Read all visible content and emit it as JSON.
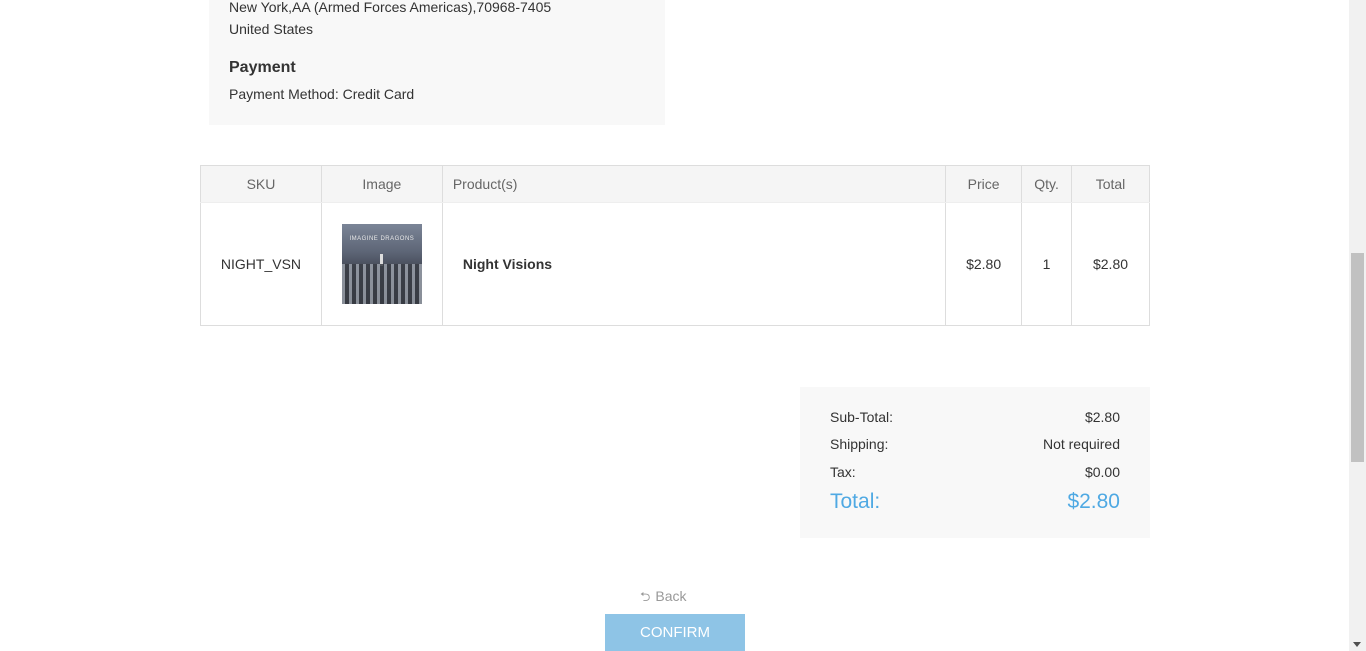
{
  "address": {
    "line1": "New York,AA (Armed Forces Americas),70968-7405",
    "line2": "United States"
  },
  "payment": {
    "heading": "Payment",
    "method": "Payment Method: Credit Card"
  },
  "table": {
    "headers": {
      "sku": "SKU",
      "image": "Image",
      "product": "Product(s)",
      "price": "Price",
      "qty": "Qty.",
      "total": "Total"
    },
    "rows": [
      {
        "sku": "NIGHT_VSN",
        "image_icon": "album-cover-image",
        "album_text": "IMAGINE DRAGONS",
        "product": "Night Visions",
        "price": "$2.80",
        "qty": "1",
        "total": "$2.80"
      }
    ]
  },
  "totals": {
    "subtotal_label": "Sub-Total:",
    "subtotal_value": "$2.80",
    "shipping_label": "Shipping:",
    "shipping_value": "Not required",
    "tax_label": "Tax:",
    "tax_value": "$0.00",
    "total_label": "Total:",
    "total_value": "$2.80"
  },
  "actions": {
    "back_label": "Back",
    "back_icon": "back-arrow-icon",
    "confirm_label": "CONFIRM"
  },
  "colors": {
    "accent": "#4fa9e3",
    "confirm_bg": "#8ec4e6",
    "panel_bg": "#f8f8f8"
  }
}
